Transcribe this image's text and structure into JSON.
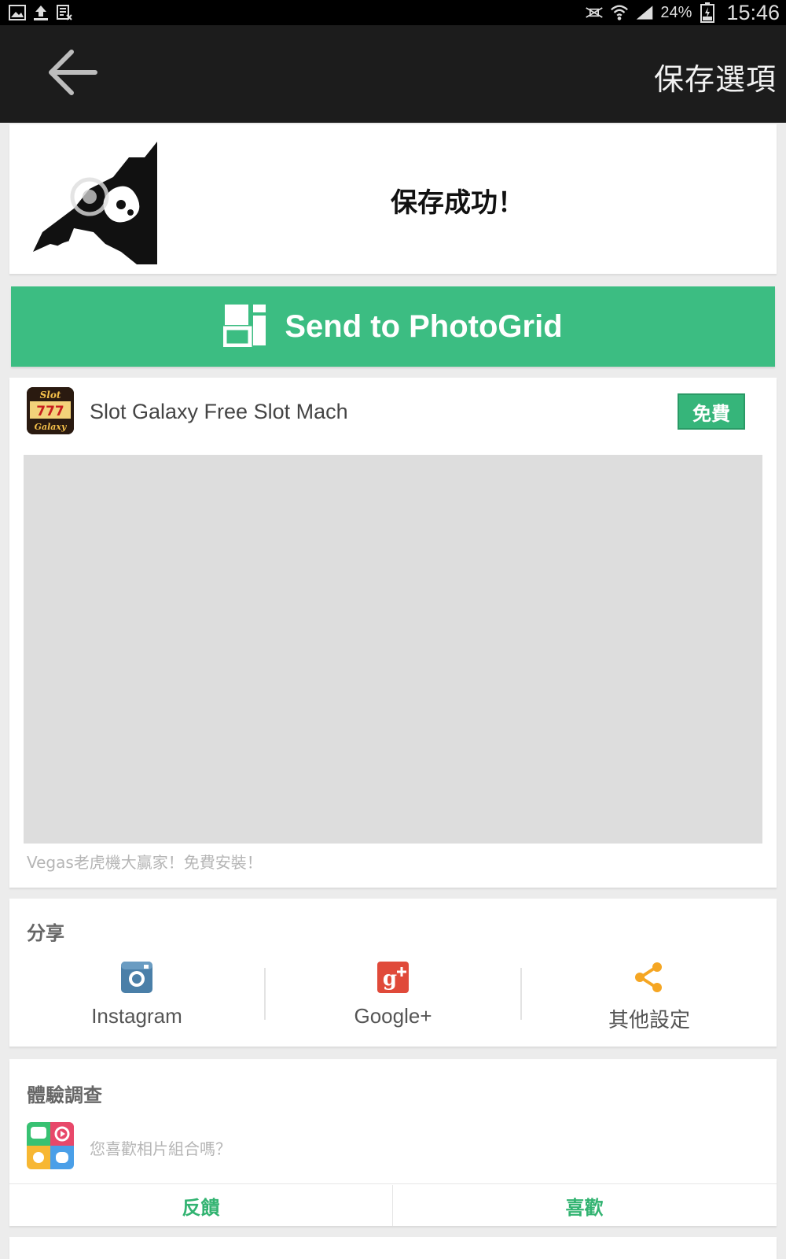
{
  "status_bar": {
    "battery": "24%",
    "time": "15:46",
    "icons": [
      "image-icon",
      "upload-icon",
      "screenshot-icon",
      "no-signal-icon",
      "wifi-icon",
      "signal-icon",
      "battery-icon"
    ]
  },
  "toolbar": {
    "back_icon": "arrow-left-icon",
    "title": "保存選項"
  },
  "saved": {
    "message": "保存成功！"
  },
  "photogrid": {
    "label": "Send to PhotoGrid",
    "icon": "photogrid-logo-icon",
    "color": "#3cbd82"
  },
  "ad": {
    "title": "Slot Galaxy Free Slot Mach",
    "badge": "免費",
    "description": "Vegas老虎機大贏家！免費安裝！",
    "icon": "slot-galaxy-app-icon",
    "icon_text": [
      "Slot",
      "777",
      "Galaxy"
    ]
  },
  "share": {
    "title": "分享",
    "items": [
      {
        "label": "Instagram",
        "icon": "instagram-icon",
        "color": "#4a7fa8"
      },
      {
        "label": "Google+",
        "icon": "google-plus-icon",
        "color": "#e04a3a"
      },
      {
        "label": "其他設定",
        "icon": "share-icon",
        "color": "#f5a623"
      }
    ]
  },
  "survey": {
    "title": "體驗調查",
    "question": "您喜歡相片組合嗎？",
    "feedback_label": "反饋",
    "like_label": "喜歡",
    "accent": "#32b371"
  }
}
